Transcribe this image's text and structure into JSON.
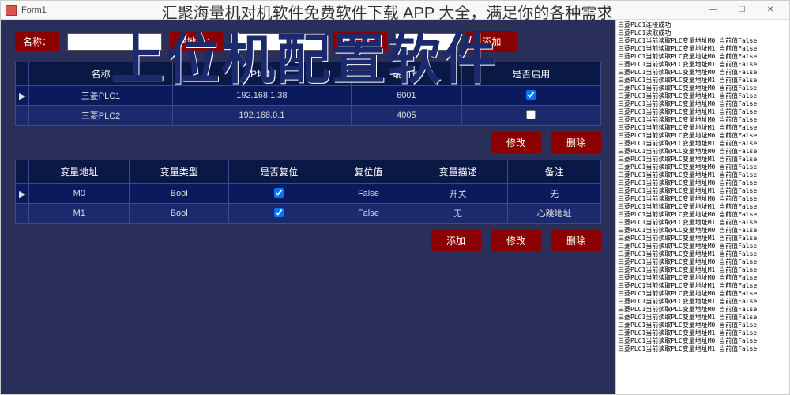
{
  "overlay_title": "汇聚海量机对机软件免费软件下载 APP 大全，满足你的各种需求",
  "watermark": "上位机配置软件",
  "window": {
    "title": "Form1"
  },
  "form": {
    "name_label": "名称：",
    "ip_label": "IP地址：",
    "port_label": "端口号：",
    "add_btn": "添加"
  },
  "grid1": {
    "headers": {
      "name": "名称",
      "ip": "IP地址",
      "port": "端口号",
      "enabled": "是否启用"
    },
    "rows": [
      {
        "name": "三菱PLC1",
        "ip": "192.168.1.38",
        "port": "6001",
        "enabled": true
      },
      {
        "name": "三菱PLC2",
        "ip": "192.168.0.1",
        "port": "4005",
        "enabled": false
      }
    ]
  },
  "buttons1": {
    "modify": "修改",
    "delete": "删除"
  },
  "grid2": {
    "headers": {
      "addr": "变量地址",
      "type": "变量类型",
      "reset": "是否复位",
      "resetval": "复位值",
      "desc": "变量描述",
      "remark": "备注"
    },
    "rows": [
      {
        "addr": "M0",
        "type": "Bool",
        "reset": true,
        "resetval": "False",
        "desc": "开关",
        "remark": "无"
      },
      {
        "addr": "M1",
        "type": "Bool",
        "reset": true,
        "resetval": "False",
        "desc": "无",
        "remark": "心跳地址"
      }
    ]
  },
  "buttons2": {
    "add": "添加",
    "modify": "修改",
    "delete": "删除"
  },
  "log": {
    "header1": "三菱PLC1连接成功",
    "header2": "三菱PLC1读取成功",
    "line_prefix": "三菱PLC1当前读取PLC变量地址M0 ",
    "line_suffix": "当前值False",
    "alt_prefix": "三菱PLC1当前读取PLC变量地址M1 "
  }
}
